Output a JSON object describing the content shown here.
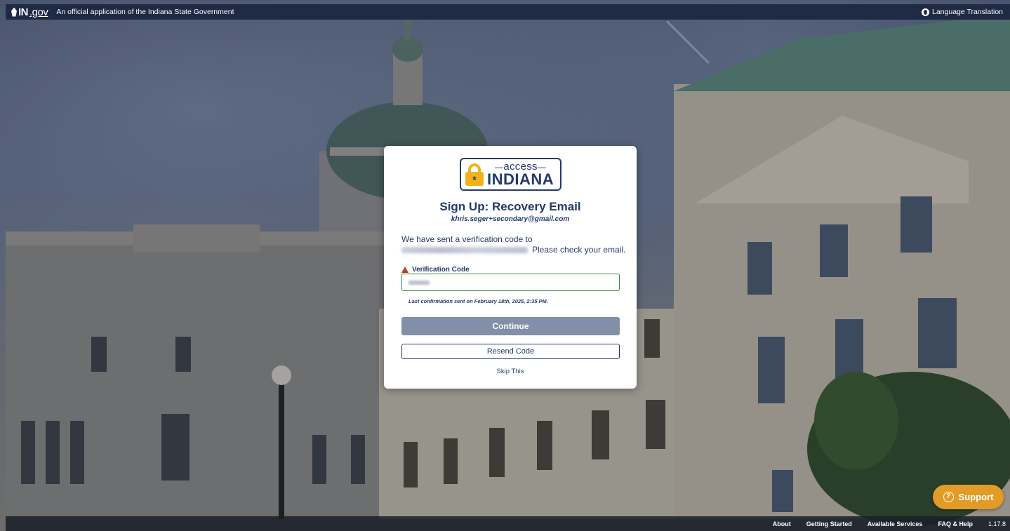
{
  "topbar": {
    "logo_text": "IN",
    "logo_suffix": ".gov",
    "tagline": "An official application of the Indiana State Government",
    "language_label": "Language Translation"
  },
  "brand": {
    "access": "access",
    "indiana": "INDIANA"
  },
  "card": {
    "title": "Sign Up: Recovery Email",
    "email": "khris.seger+secondary@gmail.com",
    "message_line1": "We have sent a verification code to",
    "message_line2_suffix": "Please check your email.",
    "field_label": "Verification Code",
    "confirmation_note": "Last confirmation sent on February 18th, 2025, 2:35 PM.",
    "continue_label": "Continue",
    "resend_label": "Resend Code",
    "skip_label": "Skip This"
  },
  "support": {
    "label": "Support"
  },
  "footer": {
    "links": [
      "About",
      "Getting Started",
      "Available Services",
      "FAQ & Help"
    ],
    "version": "1.17.8"
  },
  "colors": {
    "navy": "#243a6b",
    "gold": "#f2b21c",
    "support_orange": "#e09c26",
    "continue_disabled": "#8190a8",
    "valid_green": "#3a8a3a",
    "warning_red": "#c0392b"
  }
}
